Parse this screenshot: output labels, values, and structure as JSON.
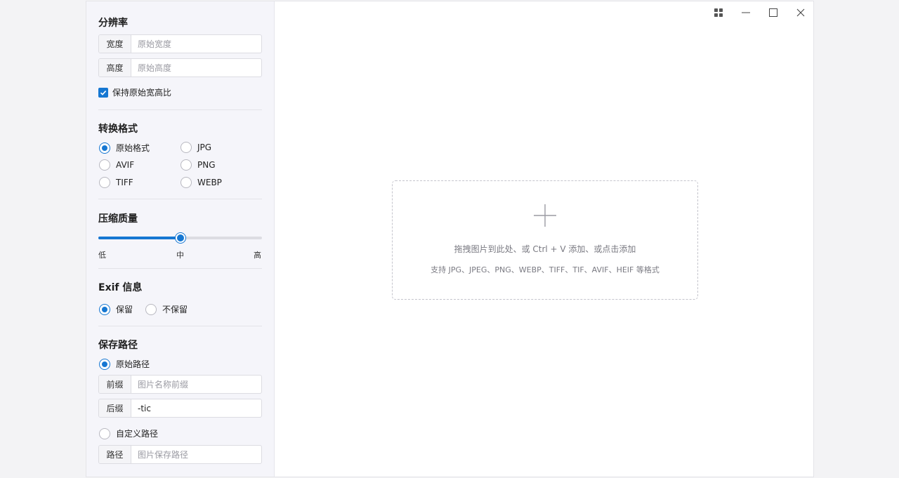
{
  "window_controls": {
    "grid": "grid-icon",
    "minimize": "minimize-icon",
    "maximize": "maximize-icon",
    "close": "close-icon"
  },
  "resolution": {
    "title": "分辨率",
    "width_label": "宽度",
    "width_value": "",
    "width_placeholder": "原始宽度",
    "height_label": "高度",
    "height_value": "",
    "height_placeholder": "原始高度",
    "keep_ratio_label": "保持原始宽高比",
    "keep_ratio_checked": true
  },
  "format": {
    "title": "转换格式",
    "options": [
      "原始格式",
      "JPG",
      "AVIF",
      "PNG",
      "TIFF",
      "WEBP"
    ],
    "selected": "原始格式"
  },
  "quality": {
    "title": "压缩质量",
    "level": 0.5,
    "ticks": [
      "低",
      "中",
      "高"
    ]
  },
  "exif": {
    "title": "Exif 信息",
    "options": [
      "保留",
      "不保留"
    ],
    "selected": "保留"
  },
  "save_path": {
    "title": "保存路径",
    "original_label": "原始路径",
    "original_selected": true,
    "prefix_label": "前缀",
    "prefix_value": "",
    "prefix_placeholder": "图片名称前缀",
    "suffix_label": "后缀",
    "suffix_value": "-tic",
    "custom_label": "自定义路径",
    "path_label": "路径",
    "path_value": "",
    "path_placeholder": "图片保存路径"
  },
  "dropzone": {
    "icon": "plus-icon",
    "hint": "拖拽图片到此处、或 Ctrl + V 添加、或点击添加",
    "formats": "支持 JPG、JPEG、PNG、WEBP、TIFF、TIF、AVIF、HEIF 等格式"
  },
  "colors": {
    "accent": "#1677d2",
    "sidebar_bg": "#f5f5fa"
  }
}
